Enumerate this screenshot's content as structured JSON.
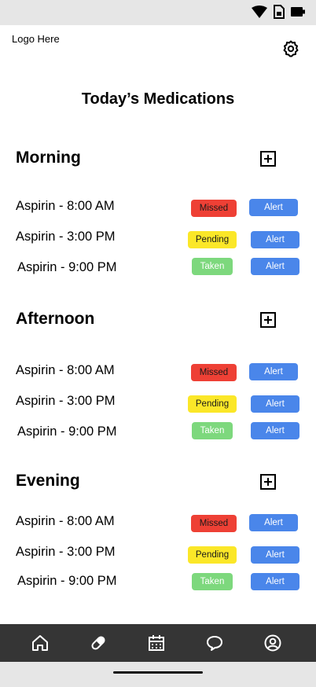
{
  "header": {
    "logo_text": "Logo Here"
  },
  "page_title": "Today’s Medications",
  "sections": [
    {
      "title": "Morning",
      "rows": [
        {
          "name": "Aspirin - 8:00 AM",
          "status": "Missed",
          "action": "Alert"
        },
        {
          "name": "Aspirin - 3:00 PM",
          "status": "Pending",
          "action": "Alert"
        },
        {
          "name": "Aspirin - 9:00 PM",
          "status": "Taken",
          "action": "Alert"
        }
      ]
    },
    {
      "title": "Afternoon",
      "rows": [
        {
          "name": "Aspirin - 8:00 AM",
          "status": "Missed",
          "action": "Alert"
        },
        {
          "name": "Aspirin - 3:00 PM",
          "status": "Pending",
          "action": "Alert"
        },
        {
          "name": "Aspirin - 9:00 PM",
          "status": "Taken",
          "action": "Alert"
        }
      ]
    },
    {
      "title": "Evening",
      "rows": [
        {
          "name": "Aspirin - 8:00 AM",
          "status": "Missed",
          "action": "Alert"
        },
        {
          "name": "Aspirin - 3:00 PM",
          "status": "Pending",
          "action": "Alert"
        },
        {
          "name": "Aspirin - 9:00 PM",
          "status": "Taken",
          "action": "Alert"
        }
      ]
    }
  ],
  "status_colors": {
    "Missed": "#ee4035",
    "Pending": "#fbe728",
    "Taken": "#7dd87d",
    "Alert": "#4a86ea"
  },
  "nav_icons": [
    "home-icon",
    "pill-icon",
    "calendar-icon",
    "chat-bubble-icon",
    "profile-icon"
  ]
}
